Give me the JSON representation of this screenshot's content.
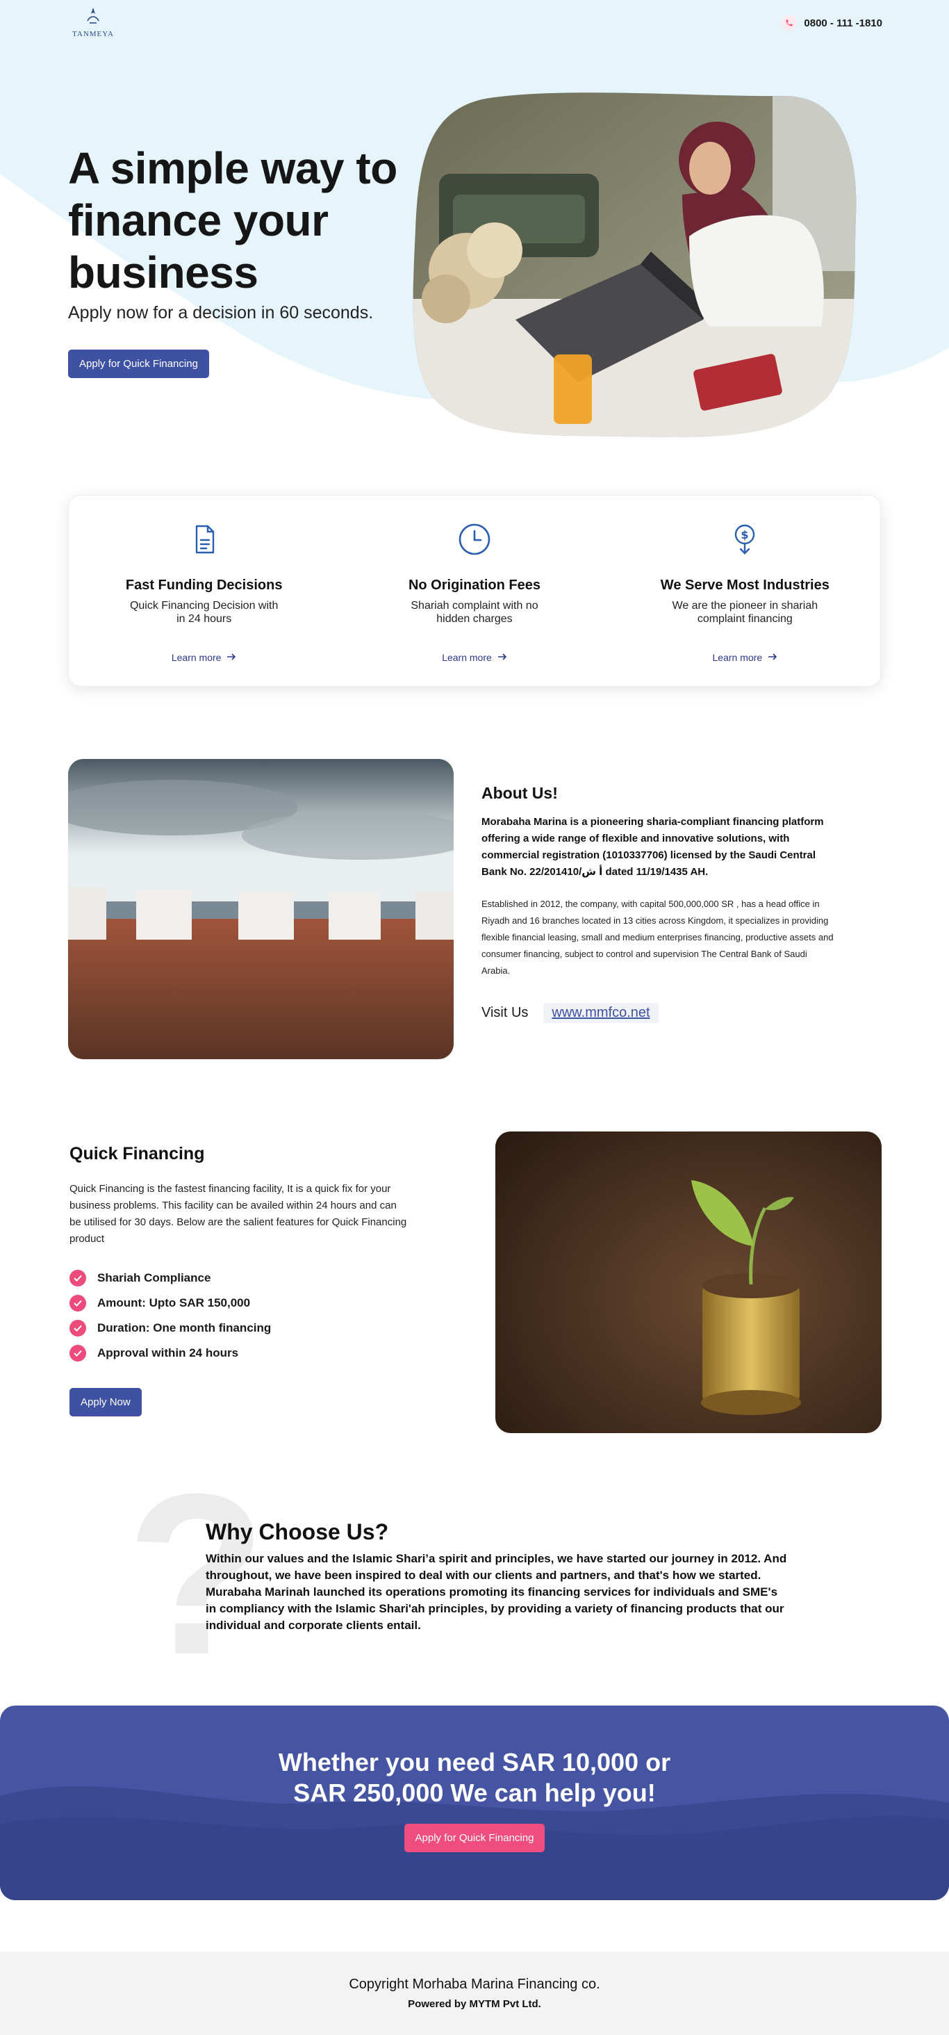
{
  "header": {
    "logo_text": "TANMEYA",
    "phone": "0800 - 111 -1810"
  },
  "hero": {
    "title": "A simple way to finance your business",
    "subtitle": "Apply now for a decision in 60 seconds.",
    "cta_label": "Apply for Quick Financing"
  },
  "features": [
    {
      "icon": "document-icon",
      "title": "Fast Funding Decisions",
      "desc": "Quick Financing Decision with in 24 hours",
      "link": "Learn more"
    },
    {
      "icon": "clock-icon",
      "title": "No Origination Fees",
      "desc": "Shariah complaint with no hidden charges",
      "link": "Learn more"
    },
    {
      "icon": "dollar-download-icon",
      "title": "We Serve Most Industries",
      "desc": "We are the pioneer in shariah complaint financing",
      "link": "Learn more"
    }
  ],
  "about": {
    "title": "About Us!",
    "lead": "Morabaha Marina is a pioneering sharia-compliant financing platform offering a wide range of flexible and innovative solutions, with commercial registration (1010337706) licensed by the Saudi Central Bank No. 22/201410/أ ش dated 11/19/1435 AH.",
    "body": "Established in 2012, the company, with capital 500,000,000 SR , has a head office in Riyadh and 16 branches located in 13 cities across Kingdom, it specializes in providing flexible financial leasing, small and medium enterprises financing, productive assets and consumer financing, subject to control and supervision The Central Bank of Saudi Arabia.",
    "visit_label": "Visit Us",
    "visit_link": "www.mmfco.net"
  },
  "quick_financing": {
    "title": "Quick Financing",
    "desc": "Quick Financing is the fastest financing facility, It is a quick fix for your business problems. This facility can be availed within 24 hours and can be utilised for 30 days. Below are the salient features for Quick Financing product",
    "items": [
      "Shariah Compliance",
      "Amount: Upto SAR 150,000",
      "Duration: One month financing",
      "Approval within 24 hours"
    ],
    "cta_label": "Apply Now"
  },
  "why": {
    "title": "Why Choose Us?",
    "body": "Within our values and the Islamic Shari’a spirit and principles, we have started our journey in 2012. And throughout, we have been inspired to deal with our clients and partners, and that's how we started. Murabaha Marinah launched its operations promoting its financing services for individuals and SME's in compliancy with the Islamic Shari'ah principles, by providing a variety of financing products that our individual and corporate clients entail."
  },
  "cta": {
    "title": "Whether you need SAR 10,000 or SAR 250,000 We can help you!",
    "button": "Apply for Quick Financing"
  },
  "footer": {
    "copyright": "Copyright Morhaba Marina Financing co.",
    "powered": "Powered by MYTM Pvt Ltd."
  },
  "colors": {
    "primary": "#3f51a3",
    "accent_pink": "#ec4b7c",
    "hero_bg": "#e6f4fc",
    "cta_bg": "#4654a4"
  }
}
